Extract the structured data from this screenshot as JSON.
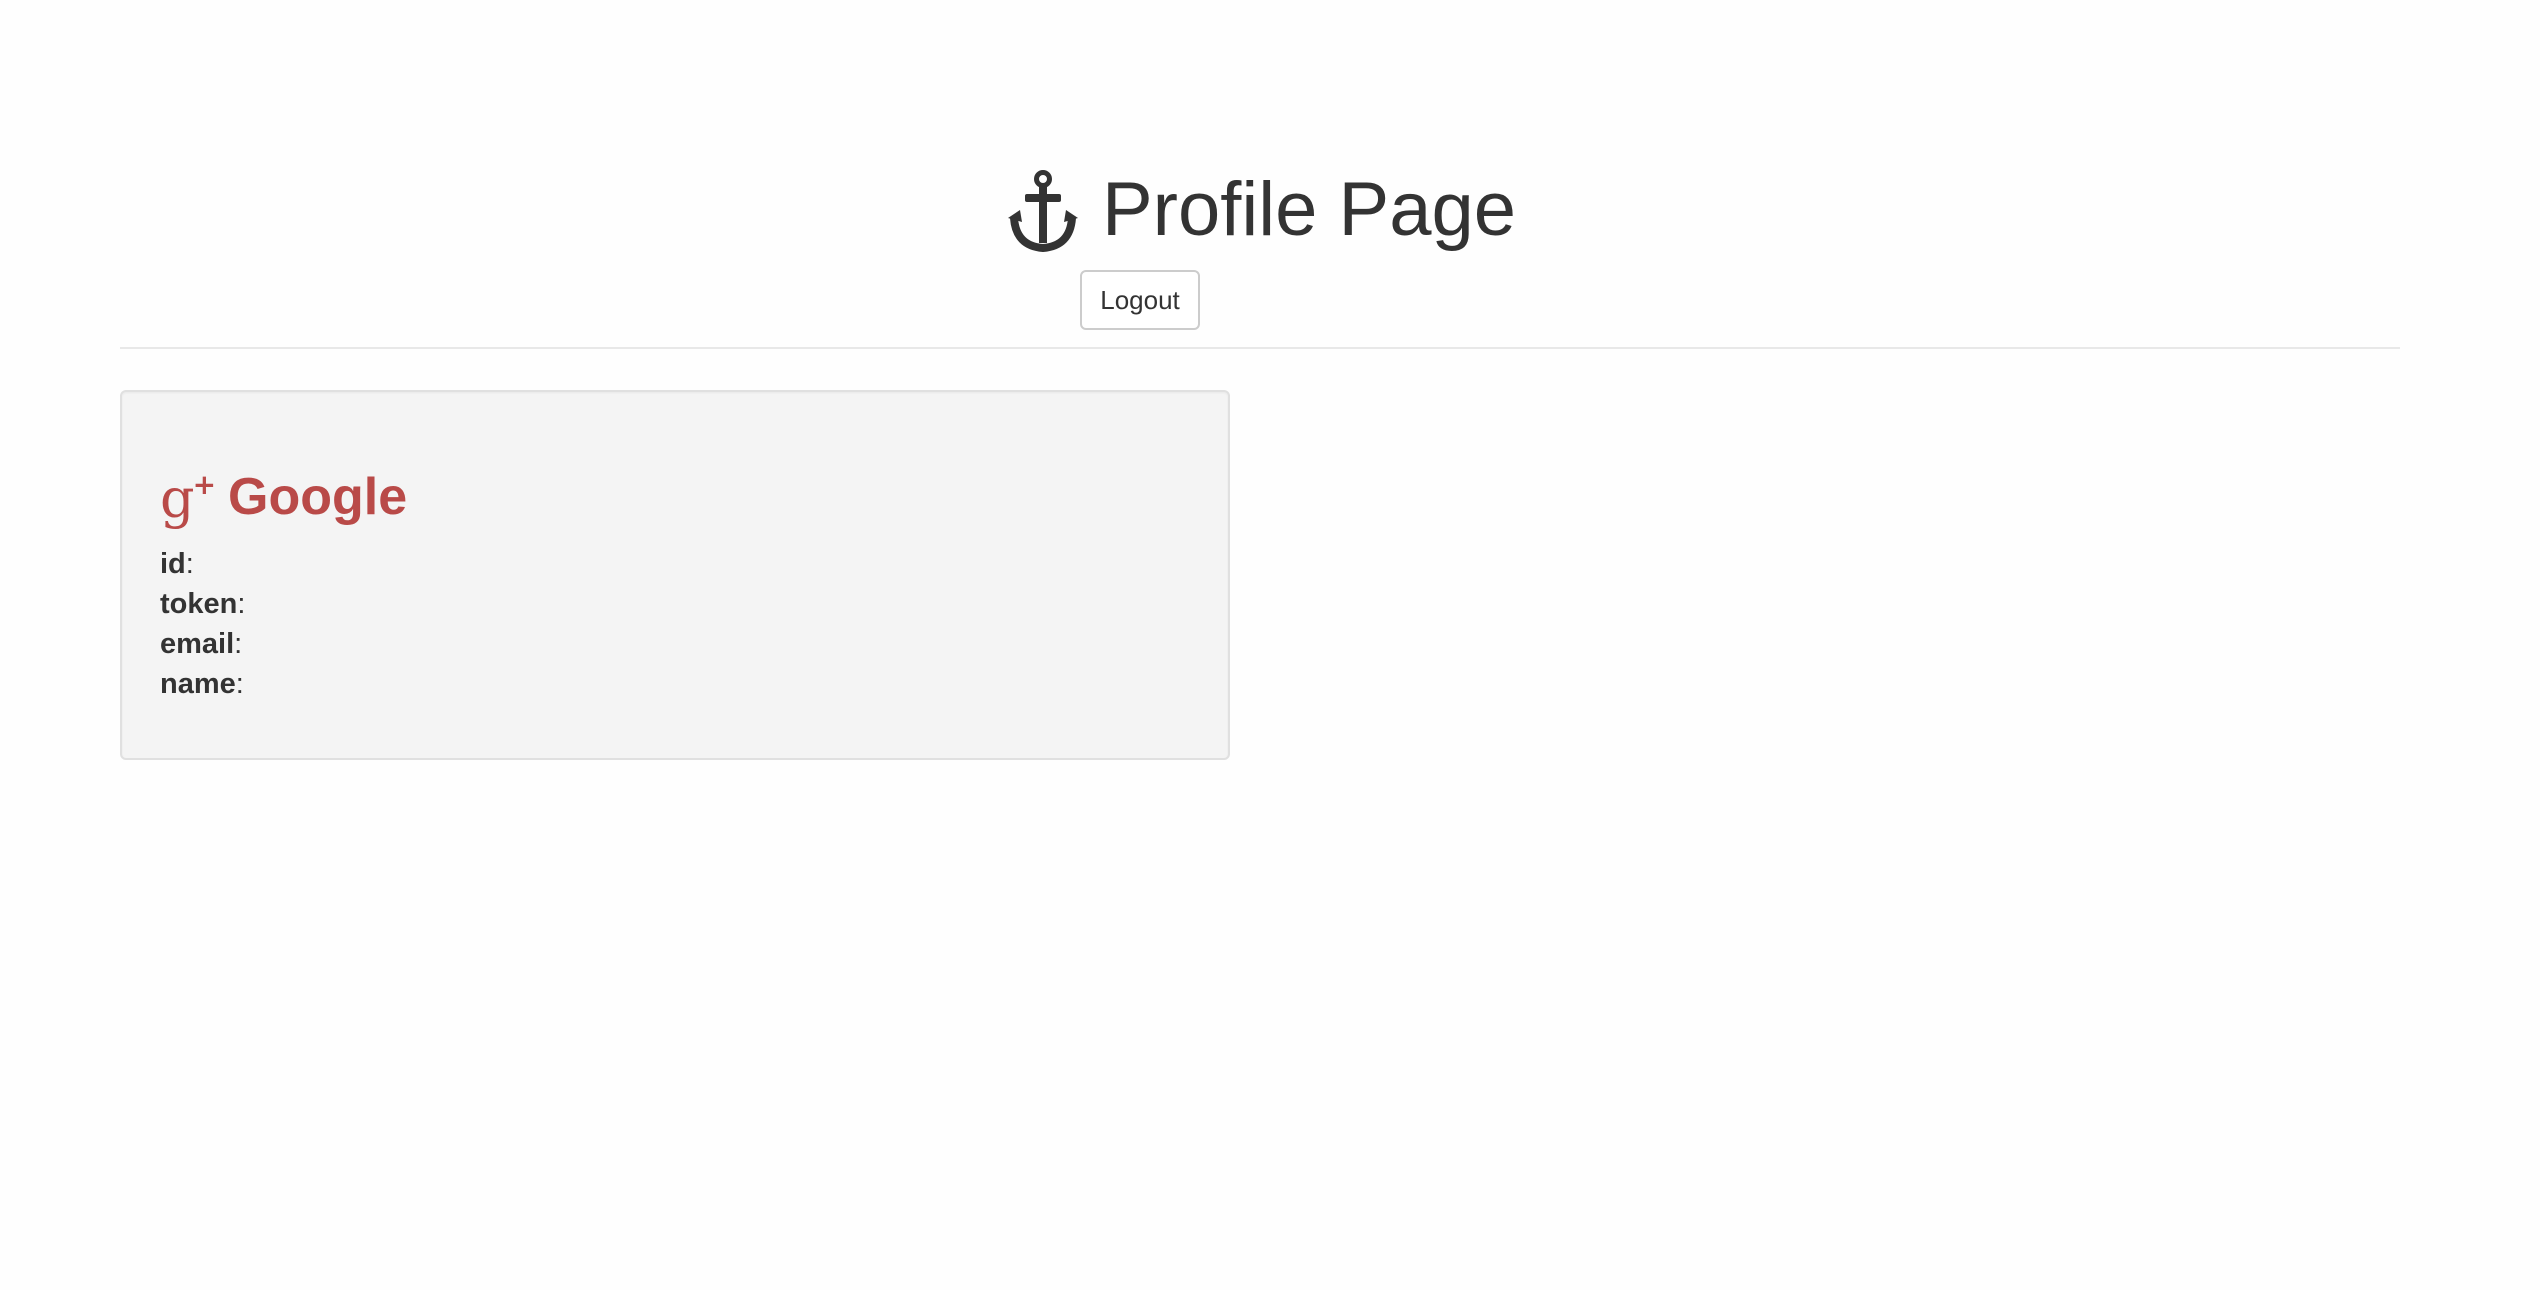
{
  "header": {
    "title": "Profile Page",
    "title_icon": "anchor-icon",
    "logout_label": "Logout"
  },
  "google_card": {
    "heading": "Google",
    "icon": "google-plus-icon",
    "icon_color": "#b94a48",
    "fields": [
      {
        "label": "id",
        "separator": ":",
        "value": ""
      },
      {
        "label": "token",
        "separator": ":",
        "value": ""
      },
      {
        "label": "email",
        "separator": ":",
        "value": ""
      },
      {
        "label": "name",
        "separator": ":",
        "value": ""
      }
    ]
  }
}
